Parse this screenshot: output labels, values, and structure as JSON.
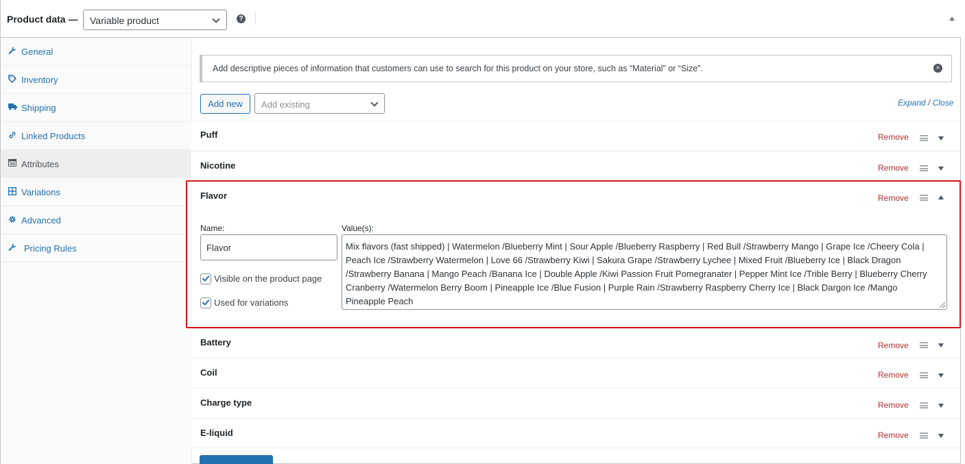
{
  "header": {
    "title": "Product data —",
    "product_type": "Variable product",
    "help_icon": "?"
  },
  "sidebar": {
    "items": [
      {
        "label": "General",
        "icon": "wrench-icon",
        "glyph": "🔧"
      },
      {
        "label": "Inventory",
        "icon": "tag-icon",
        "glyph": "🏷"
      },
      {
        "label": "Shipping",
        "icon": "truck-icon",
        "glyph": "🚚"
      },
      {
        "label": "Linked Products",
        "icon": "link-icon",
        "glyph": "🔗"
      },
      {
        "label": "Attributes",
        "icon": "list-icon",
        "glyph": "▤",
        "active": true
      },
      {
        "label": "Variations",
        "icon": "grid-icon",
        "glyph": "⊞"
      },
      {
        "label": "Advanced",
        "icon": "gear-icon",
        "glyph": "⚙"
      },
      {
        "label": "Pricing Rules",
        "icon": "wrench-icon",
        "glyph": "🔧"
      }
    ]
  },
  "notice": {
    "text": "Add descriptive pieces of information that customers can use to search for this product on your store, such as “Material” or “Size”.",
    "dismiss": "×"
  },
  "toolbar": {
    "add_new": "Add new",
    "add_existing_placeholder": "Add existing",
    "expand": "Expand",
    "separator": " / ",
    "close": "Close"
  },
  "attributes": [
    {
      "name": "Puff",
      "remove": "Remove"
    },
    {
      "name": "Nicotine",
      "remove": "Remove"
    },
    {
      "name": "Flavor",
      "remove": "Remove",
      "expanded": true
    },
    {
      "name": "Battery",
      "remove": "Remove"
    },
    {
      "name": "Coil",
      "remove": "Remove"
    },
    {
      "name": "Charge type",
      "remove": "Remove"
    },
    {
      "name": "E-liquid",
      "remove": "Remove"
    }
  ],
  "flavor_editor": {
    "name_label": "Name:",
    "name_value": "Flavor",
    "values_label": "Value(s):",
    "values_text": "Mix flavors (fast shipped) | Watermelon /Blueberry Mint | Sour Apple /Blueberry Raspberry | Red Bull /Strawberry Mango | Grape Ice /Cheery Cola | Peach Ice /Strawberry Watermelon | Love 66 /Strawberry Kiwi | Sakura Grape /Strawberry Lychee | Mixed Fruit /Blueberry Ice | Black Dragon /Strawberry Banana | Mango Peach /Banana Ice | Double Apple /Kiwi Passion Fruit Pomegranater | Pepper Mint Ice /Trible Berry | Blueberry Cherry Cranberry /Watermelon Berry Boom | Pineapple Ice /Blue Fusion | Purple Rain /Strawberry Raspberry Cherry Ice | Black Dargon Ice /Mango Pineapple Peach",
    "visible_label": "Visible on the product page",
    "visible_checked": true,
    "variations_label": "Used for variations",
    "variations_checked": true
  },
  "colors": {
    "link": "#2271b1",
    "remove": "#b32d2e",
    "highlight": "#d9121b"
  }
}
